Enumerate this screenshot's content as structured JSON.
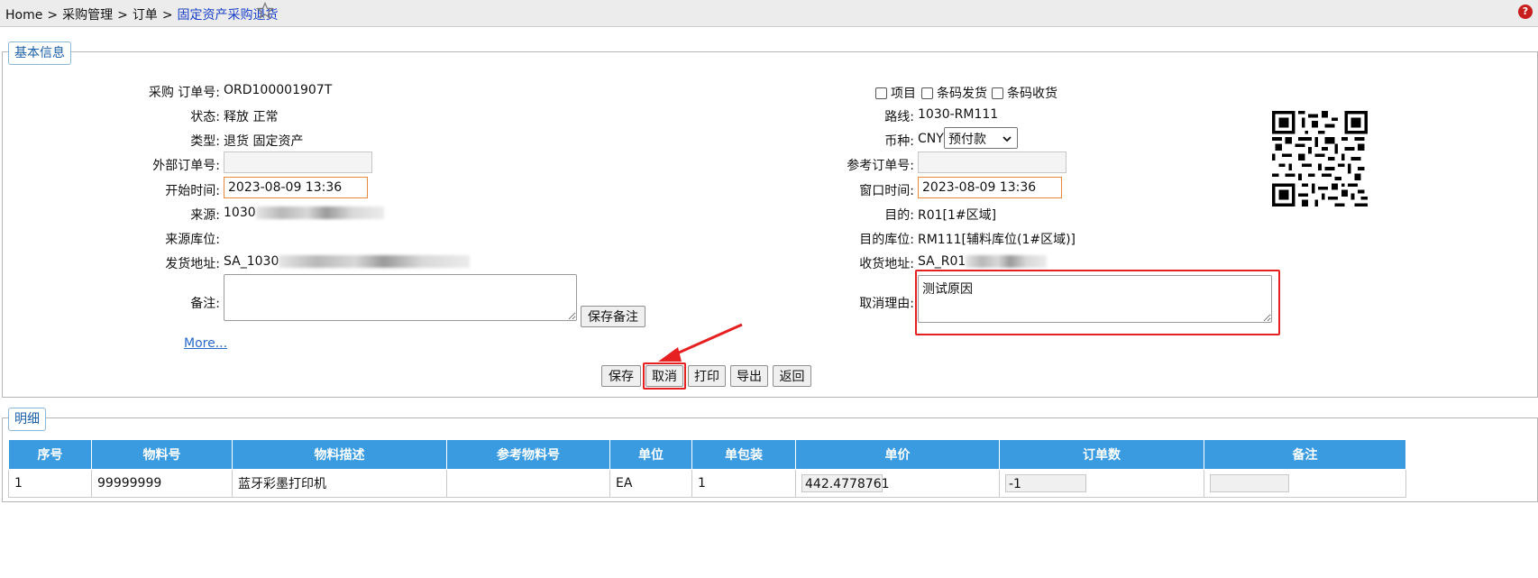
{
  "breadcrumb": [
    "Home",
    "采购管理",
    "订单",
    "固定资产采购退货"
  ],
  "breadcrumb_sep": ">",
  "icons": {
    "favorite": "star-outline-icon",
    "help": "help-icon"
  },
  "help_glyph": "?",
  "basic": {
    "legend": "基本信息",
    "left": {
      "order_no_label": "采购 订单号:",
      "order_no": "ORD100001907T",
      "status_label": "状态:",
      "status": "释放 正常",
      "type_label": "类型:",
      "type": "退货 固定资产",
      "ext_order_label": "外部订单号:",
      "ext_order_value": "",
      "start_time_label": "开始时间:",
      "start_time_value": "2023-08-09 13:36",
      "source_label": "来源:",
      "source": "1030",
      "source_loc_label": "来源库位:",
      "ship_addr_label": "发货地址:",
      "ship_addr": "SA_1030",
      "remark_label": "备注:",
      "remark_value": "",
      "save_remark_button": "保存备注",
      "more_link": "More..."
    },
    "right": {
      "chk_project": "项目",
      "chk_barcode_ship": "条码发货",
      "chk_barcode_recv": "条码收货",
      "route_label": "路线:",
      "route": "1030-RM111",
      "currency_label": "币种:",
      "currency": "CNY",
      "payment_selected": "预付款",
      "ref_order_label": "参考订单号:",
      "ref_order_value": "",
      "window_time_label": "窗口时间:",
      "window_time_value": "2023-08-09 13:36",
      "dest_label": "目的:",
      "dest": "R01[1#区域]",
      "dest_loc_label": "目的库位:",
      "dest_loc": "RM111[辅料库位(1#区域)]",
      "recv_addr_label": "收货地址:",
      "recv_addr": "SA_R01",
      "cancel_reason_label": "取消理由:",
      "cancel_reason_value": "测试原因"
    },
    "actions": {
      "save": "保存",
      "cancel": "取消",
      "print": "打印",
      "export": "导出",
      "back": "返回"
    }
  },
  "detail": {
    "legend": "明细",
    "columns": [
      "序号",
      "物料号",
      "物料描述",
      "参考物料号",
      "单位",
      "单包装",
      "单价",
      "订单数",
      "备注"
    ],
    "rows": [
      {
        "seq": "1",
        "material_no": "99999999",
        "desc": "蓝牙彩墨打印机",
        "ref_material": "",
        "unit": "EA",
        "pack": "1",
        "price": "442.4778761",
        "qty": "-1",
        "remark": ""
      }
    ]
  },
  "colors": {
    "header_blue": "#3a9be0",
    "highlight_red": "#e62020",
    "link_blue": "#2868c8"
  }
}
